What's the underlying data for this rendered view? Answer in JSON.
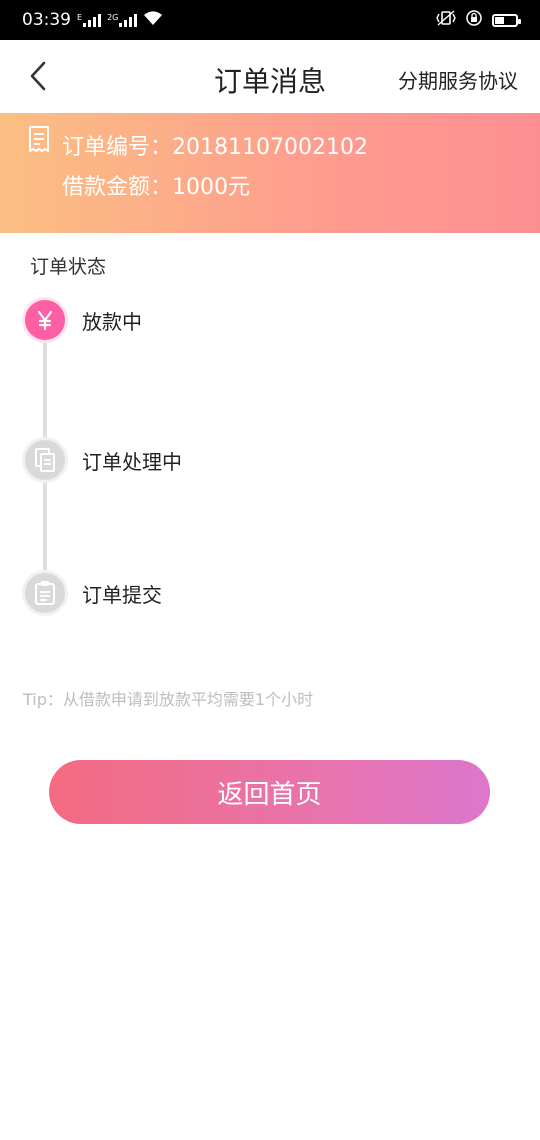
{
  "status_bar": {
    "time": "03:39",
    "sim1_label": "E",
    "sim2_label": "2G"
  },
  "nav": {
    "title": "订单消息",
    "right_link": "分期服务协议"
  },
  "banner": {
    "order_number_text": "订单编号：20181107002102",
    "loan_amount_text": "借款金额：1000元"
  },
  "order_status": {
    "section_label": "订单状态",
    "steps": [
      {
        "label": "放款中",
        "icon": "yuan-icon",
        "active": true
      },
      {
        "label": "订单处理中",
        "icon": "documents-icon",
        "active": false
      },
      {
        "label": "订单提交",
        "icon": "clipboard-icon",
        "active": false
      }
    ]
  },
  "tip": "Tip：从借款申请到放款平均需要1个小时",
  "home_button": "返回首页",
  "colors": {
    "banner_start": "#fbbf82",
    "banner_end": "#fd8f93",
    "active_step": "#fd5fa5",
    "button_start": "#f26b80",
    "button_end": "#dc77cc"
  }
}
